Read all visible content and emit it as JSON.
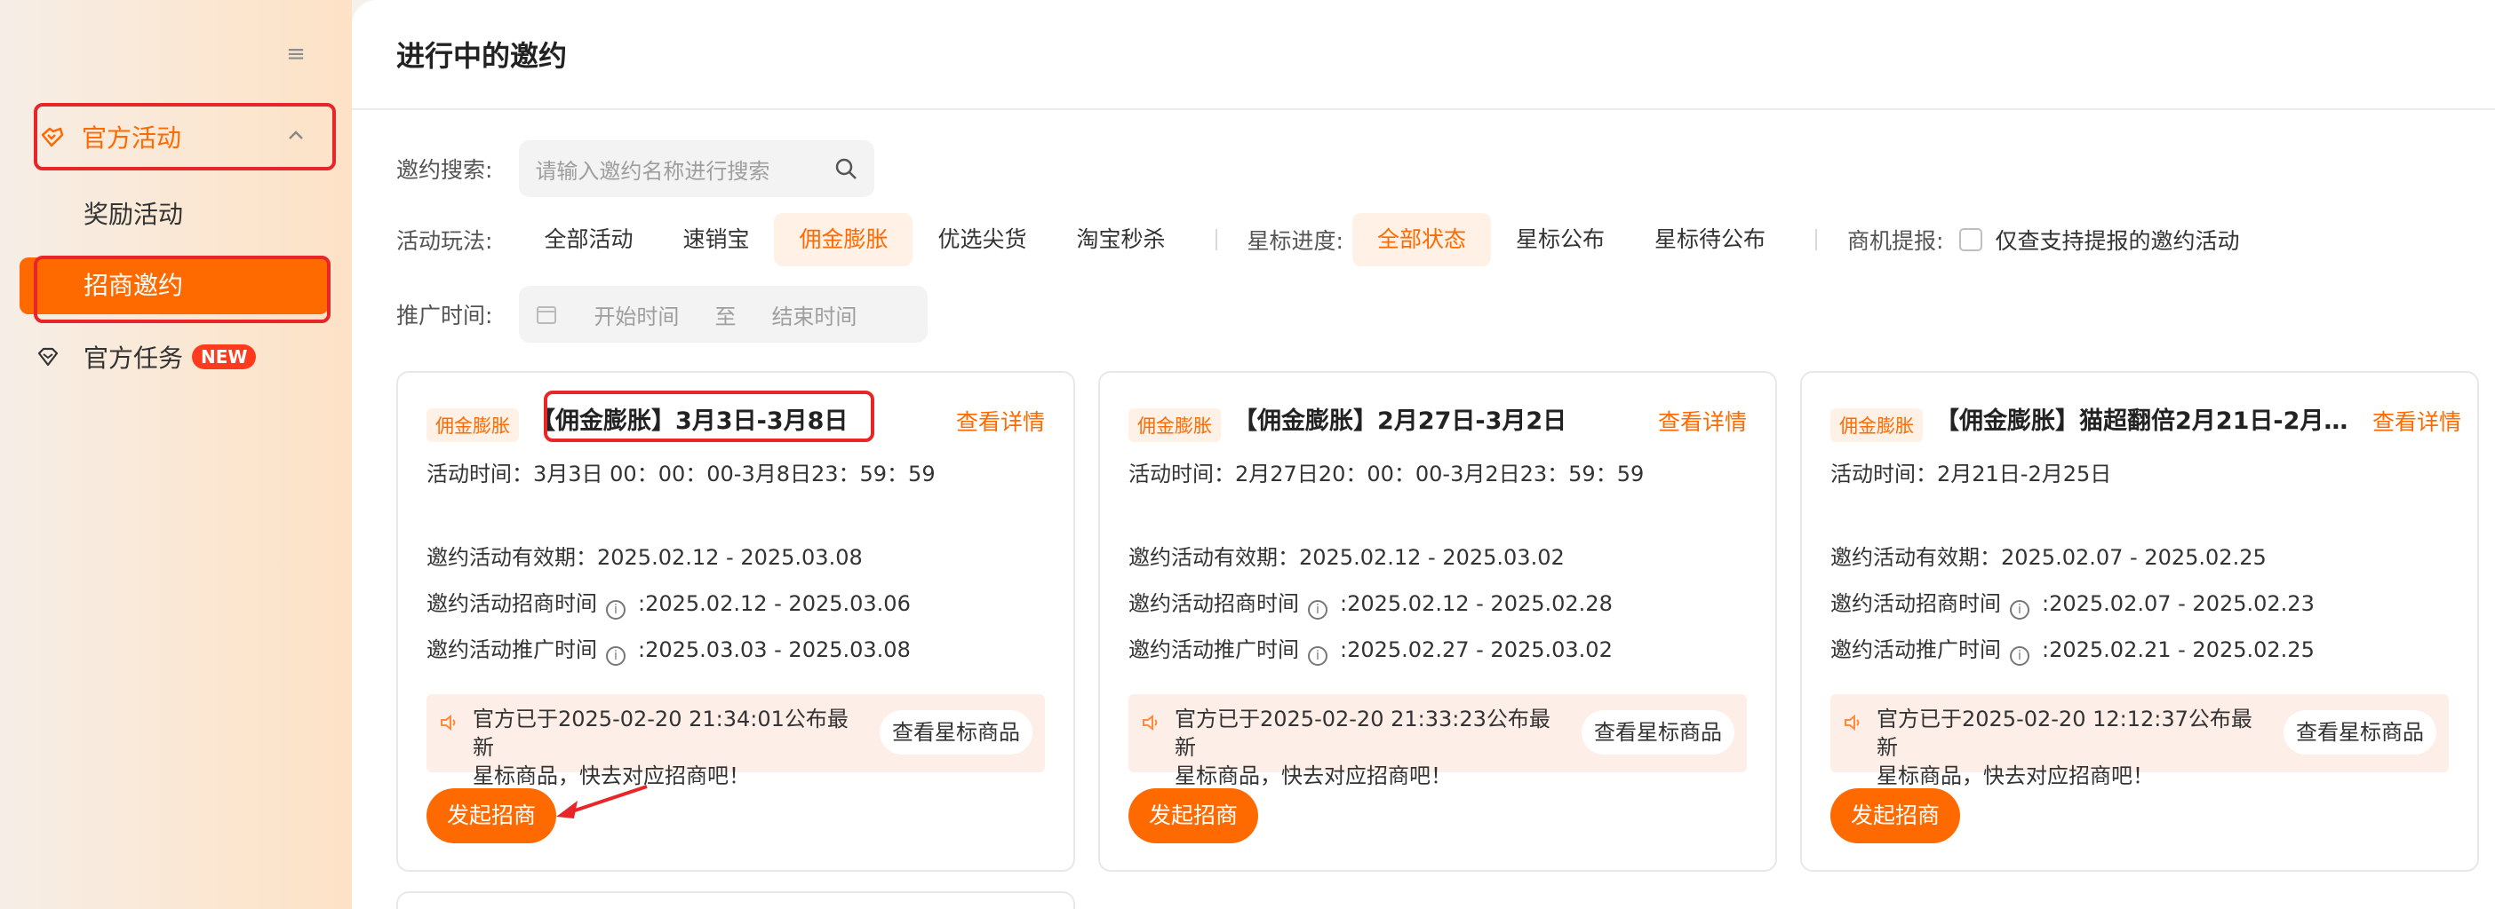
{
  "sidebar": {
    "collapse_icon": "menu-collapse-icon",
    "group_label": "官方活动",
    "sub_reward": "奖励活动",
    "sub_active": "招商邀约",
    "task_label": "官方任务",
    "task_badge": "NEW"
  },
  "header": {
    "title": "进行中的邀约"
  },
  "filters": {
    "search_label": "邀约搜索:",
    "search_placeholder": "请输入邀约名称进行搜索",
    "mode_label": "活动玩法:",
    "modes": [
      "全部活动",
      "速销宝",
      "佣金膨胀",
      "优选尖货",
      "淘宝秒杀"
    ],
    "active_mode": "佣金膨胀",
    "star_label": "星标进度:",
    "stars": [
      "全部状态",
      "星标公布",
      "星标待公布"
    ],
    "active_star": "全部状态",
    "biz_label": "商机提报:",
    "biz_checkbox": "仅查支持提报的邀约活动",
    "time_label": "推广时间:",
    "start_placeholder": "开始时间",
    "to": "至",
    "end_placeholder": "结束时间"
  },
  "cards": [
    {
      "tag": "佣金膨胀",
      "title": "【佣金膨胀】3月3日-3月8日",
      "detail": "查看详情",
      "activity_time": "活动时间：3月3日 00：00：00-3月8日23：59：59",
      "valid_label": "邀约活动有效期：",
      "valid": "2025.02.12 - 2025.03.08",
      "recruit_label": "邀约活动招商时间",
      "recruit": "2025.02.12 - 2025.03.06",
      "promo_label": "邀约活动推广时间",
      "promo": "2025.03.03 - 2025.03.08",
      "notice_l1": "官方已于2025-02-20 21:34:01公布最新",
      "notice_l2": "星标商品，快去对应招商吧！",
      "star_btn": "查看星标商品",
      "launch": "发起招商"
    },
    {
      "tag": "佣金膨胀",
      "title": "【佣金膨胀】2月27日-3月2日",
      "detail": "查看详情",
      "activity_time": "活动时间：2月27日20：00：00-3月2日23：59：59",
      "valid_label": "邀约活动有效期：",
      "valid": "2025.02.12 - 2025.03.02",
      "recruit_label": "邀约活动招商时间",
      "recruit": "2025.02.12 - 2025.02.28",
      "promo_label": "邀约活动推广时间",
      "promo": "2025.02.27 - 2025.03.02",
      "notice_l1": "官方已于2025-02-20 21:33:23公布最新",
      "notice_l2": "星标商品，快去对应招商吧！",
      "star_btn": "查看星标商品",
      "launch": "发起招商"
    },
    {
      "tag": "佣金膨胀",
      "title": "【佣金膨胀】猫超翻倍2月21日-2月25...",
      "detail": "查看详情",
      "activity_time": "活动时间：2月21日-2月25日",
      "valid_label": "邀约活动有效期：",
      "valid": "2025.02.07 - 2025.02.25",
      "recruit_label": "邀约活动招商时间",
      "recruit": "2025.02.07 - 2025.02.23",
      "promo_label": "邀约活动推广时间",
      "promo": "2025.02.21 - 2025.02.25",
      "notice_l1": "官方已于2025-02-20 12:12:37公布最新",
      "notice_l2": "星标商品，快去对应招商吧！",
      "star_btn": "查看星标商品",
      "launch": "发起招商"
    }
  ],
  "colors": {
    "accent": "#ff6a00",
    "annotation": "#e8262a"
  }
}
